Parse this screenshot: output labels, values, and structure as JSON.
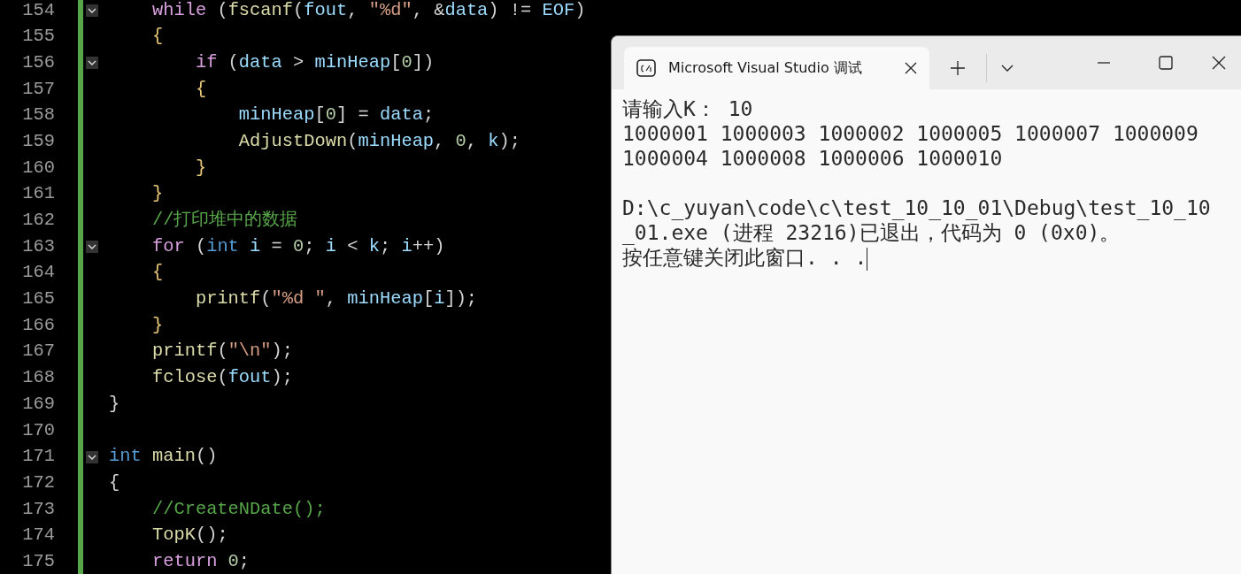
{
  "editor": {
    "lines": [
      {
        "number": "154",
        "fold": true,
        "tokens": [
          {
            "kind": "keyword",
            "text": "    while"
          },
          {
            "kind": "punct",
            "text": " ("
          },
          {
            "kind": "function",
            "text": "fscanf"
          },
          {
            "kind": "punct",
            "text": "("
          },
          {
            "kind": "variable",
            "text": "fout"
          },
          {
            "kind": "punct",
            "text": ", "
          },
          {
            "kind": "string",
            "text": "\"%d\""
          },
          {
            "kind": "punct",
            "text": ", &"
          },
          {
            "kind": "variable",
            "text": "data"
          },
          {
            "kind": "punct",
            "text": ") != "
          },
          {
            "kind": "variable",
            "text": "EOF"
          },
          {
            "kind": "punct",
            "text": ")"
          }
        ]
      },
      {
        "number": "155",
        "fold": false,
        "tokens": [
          {
            "kind": "brace",
            "text": "    {"
          }
        ]
      },
      {
        "number": "156",
        "fold": true,
        "tokens": [
          {
            "kind": "keyword",
            "text": "        if"
          },
          {
            "kind": "punct",
            "text": " ("
          },
          {
            "kind": "variable",
            "text": "data"
          },
          {
            "kind": "punct",
            "text": " > "
          },
          {
            "kind": "variable",
            "text": "minHeap"
          },
          {
            "kind": "punct",
            "text": "["
          },
          {
            "kind": "number",
            "text": "0"
          },
          {
            "kind": "punct",
            "text": "])"
          }
        ]
      },
      {
        "number": "157",
        "fold": false,
        "tokens": [
          {
            "kind": "brace",
            "text": "        {"
          }
        ]
      },
      {
        "number": "158",
        "fold": false,
        "tokens": [
          {
            "kind": "variable",
            "text": "            minHeap"
          },
          {
            "kind": "punct",
            "text": "["
          },
          {
            "kind": "number",
            "text": "0"
          },
          {
            "kind": "punct",
            "text": "] = "
          },
          {
            "kind": "variable",
            "text": "data"
          },
          {
            "kind": "punct",
            "text": ";"
          }
        ]
      },
      {
        "number": "159",
        "fold": false,
        "tokens": [
          {
            "kind": "function",
            "text": "            AdjustDown"
          },
          {
            "kind": "punct",
            "text": "("
          },
          {
            "kind": "variable",
            "text": "minHeap"
          },
          {
            "kind": "punct",
            "text": ", "
          },
          {
            "kind": "number",
            "text": "0"
          },
          {
            "kind": "punct",
            "text": ", "
          },
          {
            "kind": "variable",
            "text": "k"
          },
          {
            "kind": "punct",
            "text": ");"
          }
        ]
      },
      {
        "number": "160",
        "fold": false,
        "tokens": [
          {
            "kind": "brace",
            "text": "        }"
          }
        ]
      },
      {
        "number": "161",
        "fold": false,
        "tokens": [
          {
            "kind": "brace",
            "text": "    }"
          }
        ]
      },
      {
        "number": "162",
        "fold": false,
        "tokens": [
          {
            "kind": "comment",
            "text": "    //打印堆中的数据"
          }
        ]
      },
      {
        "number": "163",
        "fold": true,
        "tokens": [
          {
            "kind": "keyword",
            "text": "    for"
          },
          {
            "kind": "punct",
            "text": " ("
          },
          {
            "kind": "type",
            "text": "int"
          },
          {
            "kind": "variable",
            "text": " i"
          },
          {
            "kind": "punct",
            "text": " = "
          },
          {
            "kind": "number",
            "text": "0"
          },
          {
            "kind": "punct",
            "text": "; "
          },
          {
            "kind": "variable",
            "text": "i"
          },
          {
            "kind": "punct",
            "text": " < "
          },
          {
            "kind": "variable",
            "text": "k"
          },
          {
            "kind": "punct",
            "text": "; "
          },
          {
            "kind": "variable",
            "text": "i"
          },
          {
            "kind": "punct",
            "text": "++)"
          }
        ]
      },
      {
        "number": "164",
        "fold": false,
        "tokens": [
          {
            "kind": "brace",
            "text": "    {"
          }
        ]
      },
      {
        "number": "165",
        "fold": false,
        "tokens": [
          {
            "kind": "function",
            "text": "        printf"
          },
          {
            "kind": "punct",
            "text": "("
          },
          {
            "kind": "string",
            "text": "\"%d \""
          },
          {
            "kind": "punct",
            "text": ", "
          },
          {
            "kind": "variable",
            "text": "minHeap"
          },
          {
            "kind": "punct",
            "text": "["
          },
          {
            "kind": "variable",
            "text": "i"
          },
          {
            "kind": "punct",
            "text": "]);"
          }
        ]
      },
      {
        "number": "166",
        "fold": false,
        "tokens": [
          {
            "kind": "brace",
            "text": "    }"
          }
        ]
      },
      {
        "number": "167",
        "fold": false,
        "tokens": [
          {
            "kind": "function",
            "text": "    printf"
          },
          {
            "kind": "punct",
            "text": "("
          },
          {
            "kind": "string",
            "text": "\"\\n\""
          },
          {
            "kind": "punct",
            "text": ");"
          }
        ]
      },
      {
        "number": "168",
        "fold": false,
        "tokens": [
          {
            "kind": "function",
            "text": "    fclose"
          },
          {
            "kind": "punct",
            "text": "("
          },
          {
            "kind": "variable",
            "text": "fout"
          },
          {
            "kind": "punct",
            "text": ");"
          }
        ]
      },
      {
        "number": "169",
        "fold": false,
        "tokens": [
          {
            "kind": "punct",
            "text": "}"
          }
        ]
      },
      {
        "number": "170",
        "fold": false
      },
      {
        "number": "171",
        "fold": true,
        "tokens": [
          {
            "kind": "type",
            "text": "int"
          },
          {
            "kind": "function",
            "text": " main"
          },
          {
            "kind": "punct",
            "text": "()"
          }
        ]
      },
      {
        "number": "172",
        "fold": false,
        "tokens": [
          {
            "kind": "punct",
            "text": "{"
          }
        ]
      },
      {
        "number": "173",
        "fold": false,
        "tokens": [
          {
            "kind": "comment",
            "text": "    //CreateNDate();"
          }
        ]
      },
      {
        "number": "174",
        "fold": false,
        "tokens": [
          {
            "kind": "function",
            "text": "    TopK"
          },
          {
            "kind": "punct",
            "text": "();"
          }
        ]
      },
      {
        "number": "175",
        "fold": false,
        "tokens": [
          {
            "kind": "keyword",
            "text": "    return"
          },
          {
            "kind": "number",
            "text": " 0"
          },
          {
            "kind": "punct",
            "text": ";"
          }
        ]
      }
    ]
  },
  "console": {
    "tab_title": "Microsoft Visual Studio 调试",
    "paragraphs": [
      {
        "lines": [
          "请输入K： 10",
          "1000001 1000003 1000002 1000005 1000007 1000009",
          "1000004 1000008 1000006 1000010"
        ]
      },
      {
        "lines": [
          "D:\\c_yuyan\\code\\c\\test_10_10_01\\Debug\\test_10_10",
          "_01.exe (进程 23216)已退出，代码为 0 (0x0)。",
          "按任意键关闭此窗口. . ."
        ]
      }
    ]
  }
}
